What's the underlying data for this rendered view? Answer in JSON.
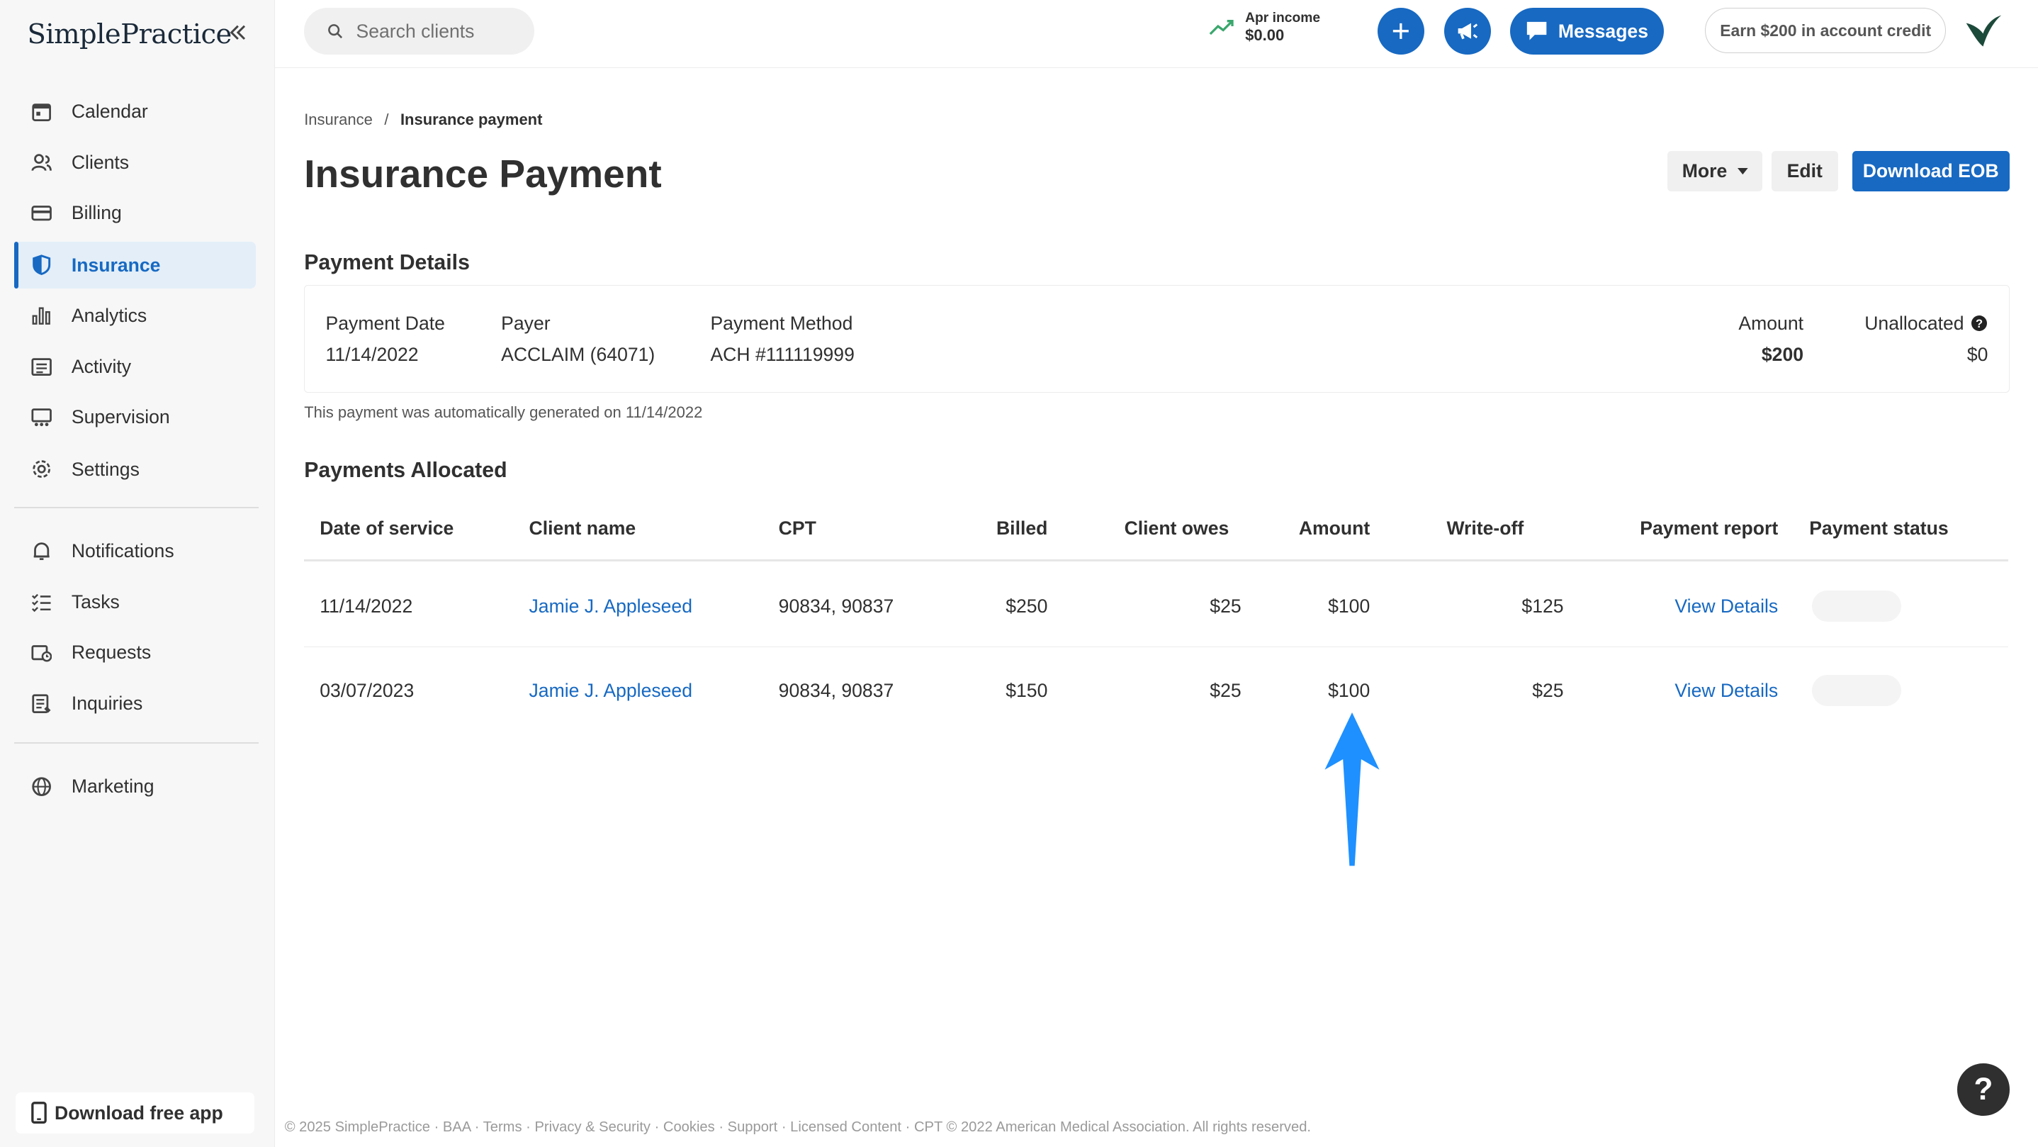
{
  "brand": {
    "logo_text": "SimplePractice"
  },
  "sidebar": {
    "items": [
      {
        "label": "Calendar",
        "icon": "calendar-icon"
      },
      {
        "label": "Clients",
        "icon": "clients-icon"
      },
      {
        "label": "Billing",
        "icon": "billing-icon"
      },
      {
        "label": "Insurance",
        "icon": "shield-icon",
        "active": true
      },
      {
        "label": "Analytics",
        "icon": "analytics-icon"
      },
      {
        "label": "Activity",
        "icon": "activity-icon"
      },
      {
        "label": "Supervision",
        "icon": "supervision-icon"
      },
      {
        "label": "Settings",
        "icon": "gear-icon"
      }
    ],
    "items2": [
      {
        "label": "Notifications",
        "icon": "bell-icon"
      },
      {
        "label": "Tasks",
        "icon": "tasks-icon"
      },
      {
        "label": "Requests",
        "icon": "requests-icon"
      },
      {
        "label": "Inquiries",
        "icon": "inquiries-icon"
      }
    ],
    "items3": [
      {
        "label": "Marketing",
        "icon": "globe-icon"
      }
    ],
    "download_app": "Download free app"
  },
  "topbar": {
    "search_placeholder": "Search clients",
    "income_label": "Apr income",
    "income_value": "$0.00",
    "messages_label": "Messages",
    "earn_label": "Earn $200 in account credit"
  },
  "breadcrumb": {
    "parent": "Insurance",
    "separator": "/",
    "current": "Insurance payment"
  },
  "page": {
    "title": "Insurance Payment",
    "more_label": "More",
    "edit_label": "Edit",
    "download_label": "Download EOB"
  },
  "payment_details": {
    "heading": "Payment Details",
    "date_label": "Payment Date",
    "date_value": "11/14/2022",
    "payer_label": "Payer",
    "payer_value": "ACCLAIM (64071)",
    "method_label": "Payment Method",
    "method_value": "ACH #111119999",
    "amount_label": "Amount",
    "amount_value": "$200",
    "unallocated_label": "Unallocated",
    "unallocated_value": "$0",
    "note": "This payment was automatically generated on 11/14/2022"
  },
  "allocated": {
    "heading": "Payments Allocated",
    "columns": [
      "Date of service",
      "Client name",
      "CPT",
      "Billed",
      "Client owes",
      "Amount",
      "Write-off",
      "Payment report",
      "Payment status"
    ],
    "rows": [
      {
        "date": "11/14/2022",
        "client": "Jamie J. Appleseed",
        "cpt": "90834, 90837",
        "billed": "$250",
        "owes": "$25",
        "amount": "$100",
        "writeoff": "$125",
        "report": "View Details"
      },
      {
        "date": "03/07/2023",
        "client": "Jamie J. Appleseed",
        "cpt": "90834, 90837",
        "billed": "$150",
        "owes": "$25",
        "amount": "$100",
        "writeoff": "$25",
        "report": "View Details"
      }
    ]
  },
  "footer": {
    "text": "© 2025 SimplePractice · BAA · Terms · Privacy & Security · Cookies · Support · Licensed Content · CPT © 2022 American Medical Association. All rights reserved."
  },
  "help": {
    "label": "?"
  },
  "colors": {
    "accent": "#1769c2",
    "active_bg": "#e3eef8",
    "annotation_arrow": "#1e90ff"
  }
}
